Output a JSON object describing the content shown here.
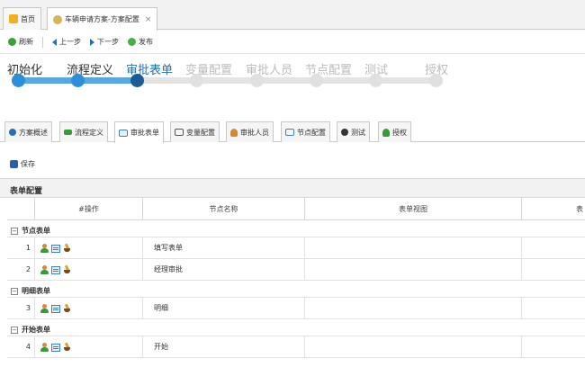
{
  "tabs": {
    "home": "首页",
    "current": "车辆申请方案-方案配置"
  },
  "toolbar": {
    "refresh": "刷新",
    "prev": "上一步",
    "next": "下一步",
    "publish": "发布"
  },
  "stepper": {
    "steps": [
      "初始化",
      "流程定义",
      "审批表单",
      "变量配置",
      "审批人员",
      "节点配置",
      "测试",
      "授权"
    ],
    "current_index": 2
  },
  "subtabs": [
    "方案概述",
    "流程定义",
    "审批表单",
    "变量配置",
    "审批人员",
    "节点配置",
    "测试",
    "授权"
  ],
  "active_subtab": "审批表单",
  "save_label": "保存",
  "section_title": "表单配置",
  "table": {
    "columns": [
      "#操作",
      "节点名称",
      "表单视图",
      "表"
    ],
    "groups": [
      {
        "name": "节点表单",
        "rows": [
          {
            "num": "1",
            "node": "填写表单"
          },
          {
            "num": "2",
            "node": "经理审批"
          }
        ]
      },
      {
        "name": "明细表单",
        "rows": [
          {
            "num": "3",
            "node": "明细"
          }
        ]
      },
      {
        "name": "开始表单",
        "rows": [
          {
            "num": "4",
            "node": "开始"
          }
        ]
      }
    ]
  },
  "colors": {
    "accent": "#1f6fb3",
    "step_done": "#2d8fd9",
    "step_track_done": "#5aa7e0",
    "step_pending": "#e0e0e0"
  }
}
